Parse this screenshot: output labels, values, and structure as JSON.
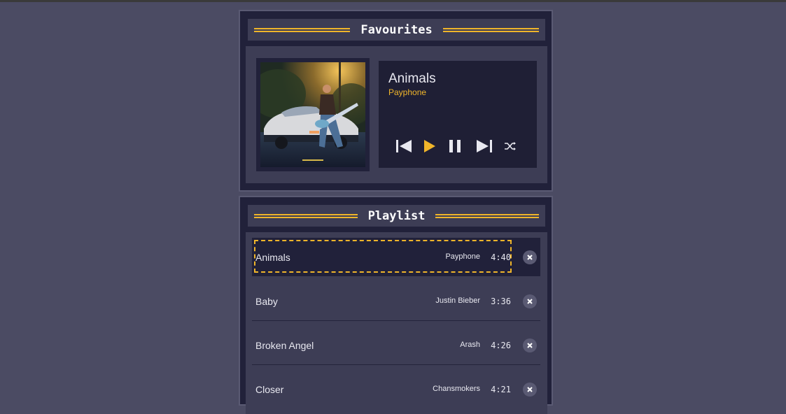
{
  "favourites": {
    "heading": "Favourites",
    "now_playing": {
      "title": "Animals",
      "artist": "Payphone"
    },
    "controls": [
      "previous-icon",
      "play-icon",
      "pause-icon",
      "next-icon",
      "shuffle-icon"
    ]
  },
  "playlist": {
    "heading": "Playlist",
    "tracks": [
      {
        "title": "Animals",
        "artist": "Payphone",
        "duration": "4:40"
      },
      {
        "title": "Baby",
        "artist": "Justin Bieber",
        "duration": "3:36"
      },
      {
        "title": "Broken Angel",
        "artist": "Arash",
        "duration": "4:26"
      },
      {
        "title": "Closer",
        "artist": "Chansmokers",
        "duration": "4:21"
      }
    ]
  },
  "colors": {
    "background": "#4b4b63",
    "panel": "#21213a",
    "panel_inner": "#3d3d55",
    "accent": "#f0b52a",
    "text": "#e8e8f0"
  }
}
